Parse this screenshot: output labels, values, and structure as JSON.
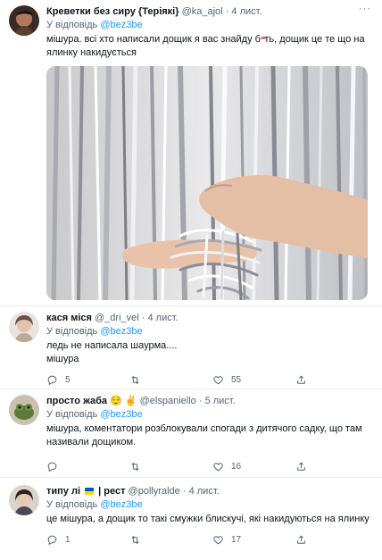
{
  "tweet1": {
    "name": "Креветки без сиру {Теріякі}",
    "handle": "@ka_ajol",
    "time": "· 4 лист.",
    "reply_prefix": "У відповідь",
    "reply_to": "@bez3be",
    "body_line1": "мішура. всі хто написали дощик я вас знайду б",
    "body_censor": "****",
    "body_line1_end": "ть, дощик це те що на",
    "body_line2": "ялинку накидується",
    "more": "···",
    "image_icon": "tinsel-curtain-photo"
  },
  "tweet2": {
    "name": "кася міся",
    "handle": "@_dri_vel",
    "time": "· 4 лист.",
    "reply_prefix": "У відповідь",
    "reply_to": "@bez3be",
    "body_line1": "ледь не написала шаурма....",
    "body_line2": "мішура",
    "replies": "5",
    "likes": "55"
  },
  "tweet3": {
    "name": "просто жаба",
    "emojis": "😌 ✌️",
    "handle": "@elspaniello",
    "time": "· 5 лист.",
    "reply_prefix": "У відповідь",
    "reply_to": "@bez3be",
    "body_line1": "мішура, коментатори розблокували спогади з дитячого садку, що там",
    "body_line2": "називали дощиком.",
    "likes": "16"
  },
  "tweet4": {
    "name": "типу лі",
    "name_suffix": "| рест",
    "handle": "@pollyralde",
    "time": "· 4 лист.",
    "reply_prefix": "У відповідь",
    "reply_to": "@bez3be",
    "body_line1": "це мішура, а дощик то такі смужки блискучі, які накидуються на ялинку",
    "replies": "1",
    "likes": "17"
  }
}
